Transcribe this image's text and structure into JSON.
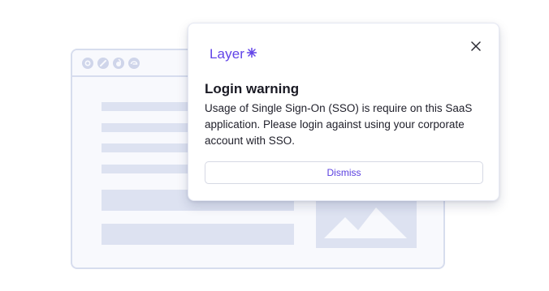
{
  "background": {
    "browser_icons": [
      "browser-icon-a",
      "browser-icon-b",
      "browser-icon-c",
      "browser-icon-d"
    ]
  },
  "dialog": {
    "brand": "Layer",
    "brand_icon": "sparkle-icon",
    "close_icon": "close-icon",
    "title": "Login warning",
    "message": "Usage of Single Sign-On (SSO) is require on this SaaS application. Please login against using your corporate account with SSO.",
    "dismiss_label": "Dismiss"
  },
  "colors": {
    "brand": "#6244e8",
    "dismiss_text": "#5a3fe0",
    "placeholder": "#dde2f1",
    "frame_border": "#d7ddee"
  }
}
